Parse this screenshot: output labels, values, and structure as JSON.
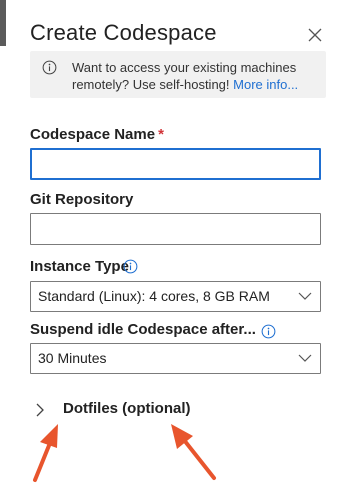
{
  "panel": {
    "title": "Create Codespace",
    "info": {
      "text": "Want to access your existing machines remotely? Use self-hosting!",
      "link": "More info..."
    },
    "fields": {
      "name": {
        "label": "Codespace Name",
        "required_mark": "*",
        "value": ""
      },
      "git": {
        "label": "Git Repository",
        "value": ""
      },
      "instance": {
        "label": "Instance Type",
        "value": "Standard (Linux): 4 cores, 8 GB RAM"
      },
      "suspend": {
        "label": "Suspend idle Codespace after...",
        "value": "30 Minutes"
      }
    },
    "dotfiles": {
      "label": "Dotfiles (optional)"
    }
  },
  "colors": {
    "accent": "#1f6fd1",
    "annotation_arrow": "#e8552d",
    "required": "#d13438"
  }
}
